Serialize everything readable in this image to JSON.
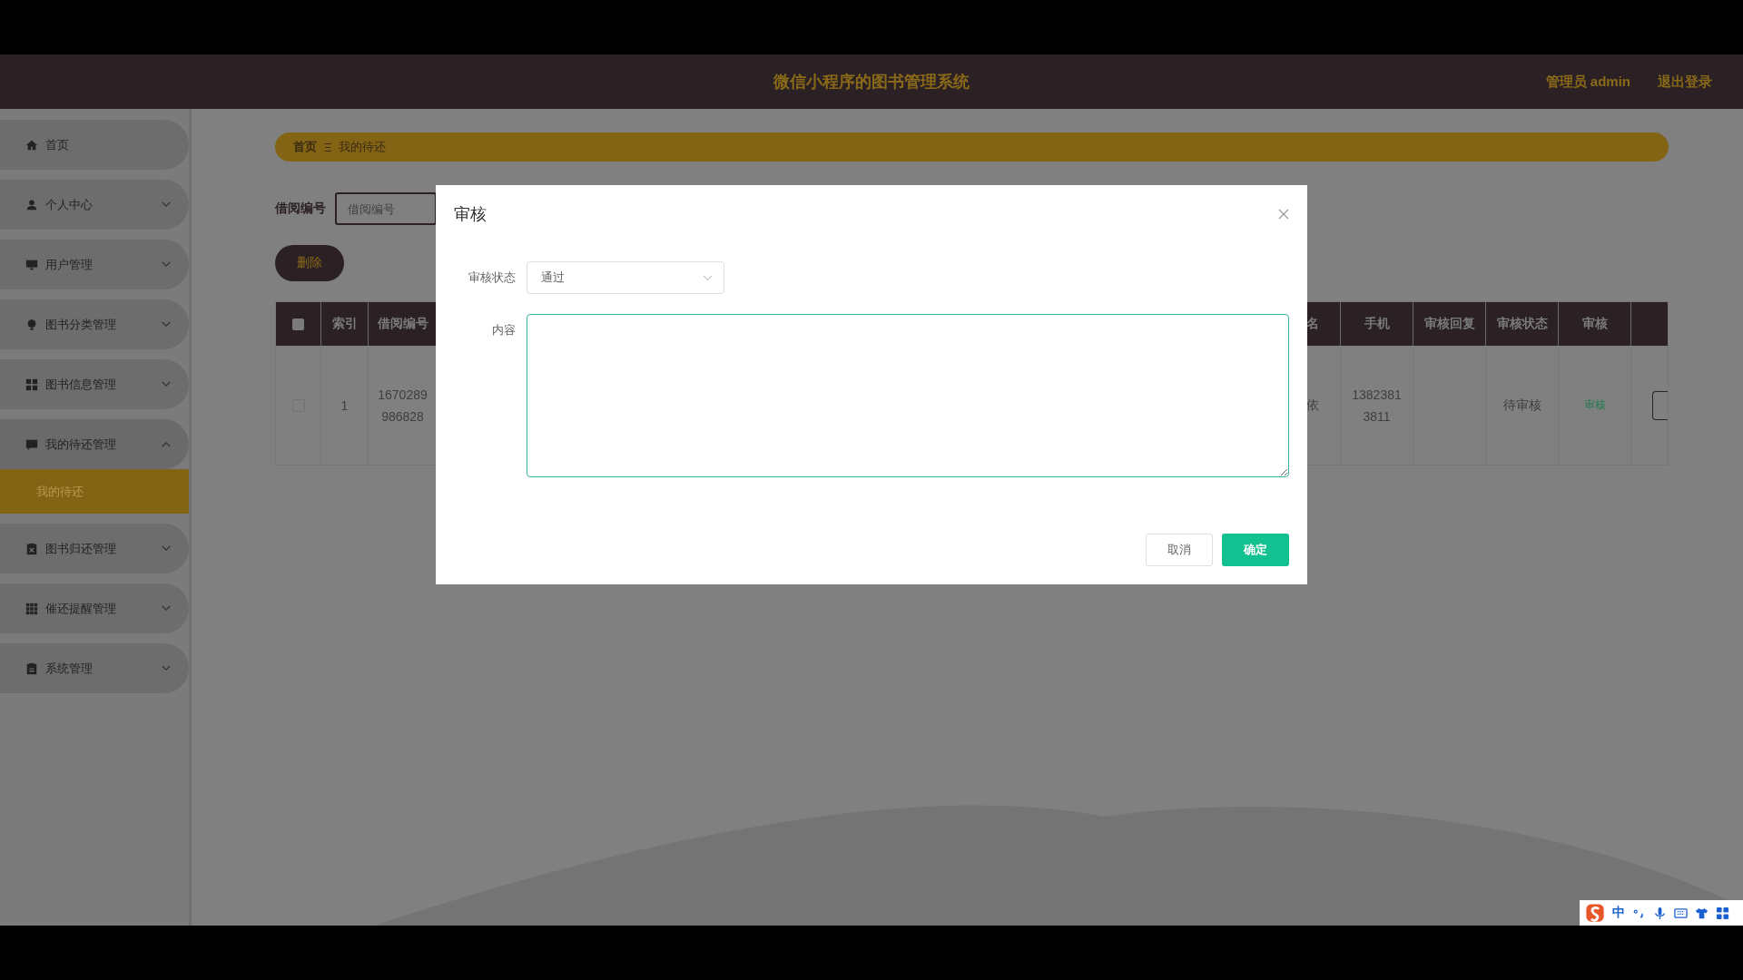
{
  "header": {
    "title": "微信小程序的图书管理系统",
    "user": "管理员 admin",
    "logout": "退出登录"
  },
  "sidebar": {
    "items": [
      {
        "label": "首页"
      },
      {
        "label": "个人中心",
        "expanded": false
      },
      {
        "label": "用户管理",
        "expanded": false
      },
      {
        "label": "图书分类管理",
        "expanded": false
      },
      {
        "label": "图书信息管理",
        "expanded": false
      },
      {
        "label": "我的待还管理",
        "expanded": true,
        "children": [
          {
            "label": "我的待还",
            "selected": true
          }
        ]
      },
      {
        "label": "图书归还管理",
        "expanded": false
      },
      {
        "label": "催还提醒管理",
        "expanded": false
      },
      {
        "label": "系统管理",
        "expanded": false
      }
    ]
  },
  "breadcrumb": {
    "items": [
      "首页",
      "我的待还"
    ],
    "separator": "Ξ"
  },
  "search": {
    "label": "借阅编号",
    "placeholder": "借阅编号"
  },
  "delete_button": "删除",
  "table": {
    "all_checked": false,
    "columns_left": [
      "索引",
      "借阅编号"
    ],
    "columns_right": [
      "名",
      "手机",
      "审核回复",
      "审核状态",
      "审核"
    ],
    "rows": [
      {
        "checked": false,
        "index": "1",
        "borrow_no": "1670289986828",
        "name": "依",
        "phone": "13823813811",
        "reply": null,
        "status": "待审核",
        "action": "审核"
      }
    ]
  },
  "dialog": {
    "title": "审核",
    "fields": [
      {
        "kind": "select",
        "label": "审核状态",
        "value": "通过"
      },
      {
        "kind": "textarea",
        "label": "内容"
      }
    ],
    "cancel": "取消",
    "confirm": "确定"
  },
  "ime": {
    "mode": "中"
  }
}
